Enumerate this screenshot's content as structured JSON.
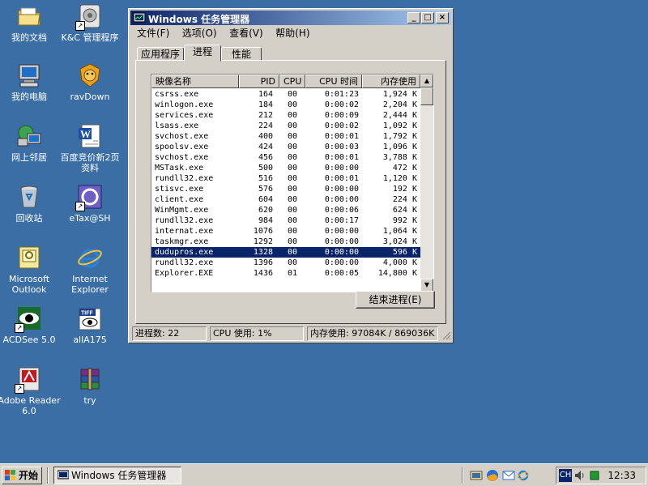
{
  "desktop_icons": [
    {
      "label": "我的文档",
      "icon": "my-documents-folder-icon"
    },
    {
      "label": "我的电脑",
      "icon": "my-computer-icon"
    },
    {
      "label": "网上邻居",
      "icon": "network-neighborhood-icon"
    },
    {
      "label": "回收站",
      "icon": "recycle-bin-icon"
    },
    {
      "label": "Microsoft Outlook",
      "icon": "outlook-icon"
    },
    {
      "label": "ACDSee 5.0",
      "icon": "acdsee-eye-icon"
    },
    {
      "label": "Adobe Reader 6.0",
      "icon": "adobe-reader-icon"
    },
    {
      "label": "K&C 管理程序",
      "icon": "kc-program-icon"
    },
    {
      "label": "ravDown",
      "icon": "rav-lion-icon"
    },
    {
      "label": "百度竞价新2页资料",
      "icon": "word-document-icon"
    },
    {
      "label": "eTax@SH",
      "icon": "etax-icon"
    },
    {
      "label": "Internet Explorer",
      "icon": "internet-explorer-icon"
    },
    {
      "label": "allA175",
      "icon": "tiff-image-icon"
    },
    {
      "label": "try",
      "icon": "winrar-archive-icon"
    }
  ],
  "window": {
    "title": "Windows 任务管理器",
    "menu": [
      "文件(F)",
      "选项(O)",
      "查看(V)",
      "帮助(H)"
    ],
    "tabs": [
      "应用程序",
      "进程",
      "性能"
    ],
    "active_tab": "进程",
    "columns": [
      "映像名称",
      "PID",
      "CPU",
      "CPU 时间",
      "内存使用"
    ],
    "processes": [
      {
        "name": "csrss.exe",
        "pid": "164",
        "cpu": "00",
        "time": "0:01:23",
        "mem": "1,924 K"
      },
      {
        "name": "winlogon.exe",
        "pid": "184",
        "cpu": "00",
        "time": "0:00:02",
        "mem": "2,204 K"
      },
      {
        "name": "services.exe",
        "pid": "212",
        "cpu": "00",
        "time": "0:00:09",
        "mem": "2,444 K"
      },
      {
        "name": "lsass.exe",
        "pid": "224",
        "cpu": "00",
        "time": "0:00:02",
        "mem": "1,092 K"
      },
      {
        "name": "svchost.exe",
        "pid": "400",
        "cpu": "00",
        "time": "0:00:01",
        "mem": "1,792 K"
      },
      {
        "name": "spoolsv.exe",
        "pid": "424",
        "cpu": "00",
        "time": "0:00:03",
        "mem": "1,096 K"
      },
      {
        "name": "svchost.exe",
        "pid": "456",
        "cpu": "00",
        "time": "0:00:01",
        "mem": "3,788 K"
      },
      {
        "name": "MSTask.exe",
        "pid": "500",
        "cpu": "00",
        "time": "0:00:00",
        "mem": "472 K"
      },
      {
        "name": "rundll32.exe",
        "pid": "516",
        "cpu": "00",
        "time": "0:00:01",
        "mem": "1,120 K"
      },
      {
        "name": "stisvc.exe",
        "pid": "576",
        "cpu": "00",
        "time": "0:00:00",
        "mem": "192 K"
      },
      {
        "name": "client.exe",
        "pid": "604",
        "cpu": "00",
        "time": "0:00:00",
        "mem": "224 K"
      },
      {
        "name": "WinMgmt.exe",
        "pid": "620",
        "cpu": "00",
        "time": "0:00:06",
        "mem": "624 K"
      },
      {
        "name": "rundll32.exe",
        "pid": "984",
        "cpu": "00",
        "time": "0:00:17",
        "mem": "992 K"
      },
      {
        "name": "internat.exe",
        "pid": "1076",
        "cpu": "00",
        "time": "0:00:00",
        "mem": "1,064 K"
      },
      {
        "name": "taskmgr.exe",
        "pid": "1292",
        "cpu": "00",
        "time": "0:00:00",
        "mem": "3,024 K"
      },
      {
        "name": "dudupros.exe",
        "pid": "1328",
        "cpu": "00",
        "time": "0:00:00",
        "mem": "596 K",
        "selected": true
      },
      {
        "name": "rundll32.exe",
        "pid": "1396",
        "cpu": "00",
        "time": "0:00:00",
        "mem": "4,000 K"
      },
      {
        "name": "Explorer.EXE",
        "pid": "1436",
        "cpu": "01",
        "time": "0:00:05",
        "mem": "14,800 K"
      }
    ],
    "end_process_label": "结束进程(E)",
    "status": {
      "processes": "进程数: 22",
      "cpu": "CPU 使用: 1%",
      "memory": "内存使用: 97084K / 869036K"
    }
  },
  "taskbar": {
    "start_label": "开始",
    "task_button": "Windows 任务管理器",
    "tray_lang": "CH",
    "clock": "12:33"
  },
  "colors": {
    "desktop": "#3a6ea5",
    "title_start": "#0a246a",
    "title_end": "#a6caf0",
    "selection": "#0a246a",
    "face": "#d4d0c8"
  }
}
